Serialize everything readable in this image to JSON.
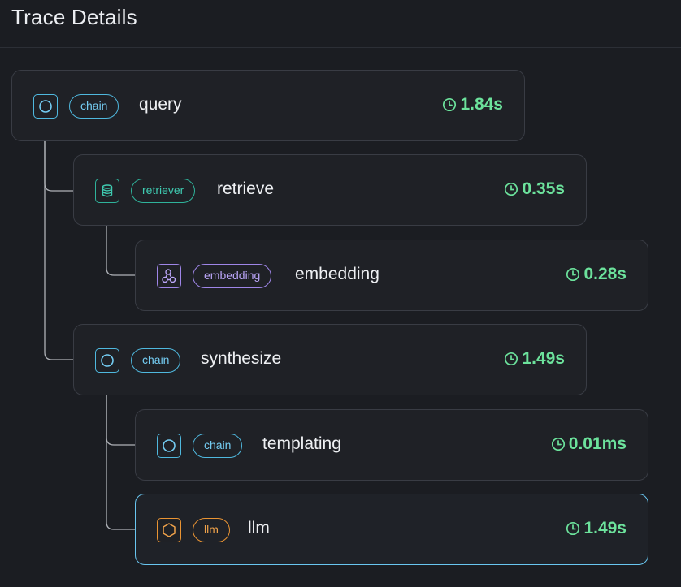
{
  "panel": {
    "title": "Trace Details"
  },
  "colors": {
    "background": "#1b1d22",
    "card": "#1f2126",
    "card_border": "#393c44",
    "selected_border": "#69c6f0",
    "latency_green": "#6ce29c",
    "chain": "#74ccf2",
    "retriever": "#3fcbb1",
    "embedding": "#b9a4f6",
    "llm": "#f0a24a",
    "connector": "#c9ccd2"
  },
  "spans": [
    {
      "kind": "chain",
      "icon": "circle-icon",
      "name": "query",
      "latency": "1.84s",
      "depth": 0,
      "selected": false
    },
    {
      "kind": "retriever",
      "icon": "database-icon",
      "name": "retrieve",
      "latency": "0.35s",
      "depth": 1,
      "selected": false
    },
    {
      "kind": "embedding",
      "icon": "nodes-icon",
      "name": "embedding",
      "latency": "0.28s",
      "depth": 2,
      "selected": false
    },
    {
      "kind": "chain",
      "icon": "circle-icon",
      "name": "synthesize",
      "latency": "1.49s",
      "depth": 1,
      "selected": false
    },
    {
      "kind": "chain",
      "icon": "circle-icon",
      "name": "templating",
      "latency": "0.01ms",
      "depth": 2,
      "selected": false
    },
    {
      "kind": "llm",
      "icon": "hexagon-icon",
      "name": "llm",
      "latency": "1.49s",
      "depth": 2,
      "selected": true
    }
  ]
}
